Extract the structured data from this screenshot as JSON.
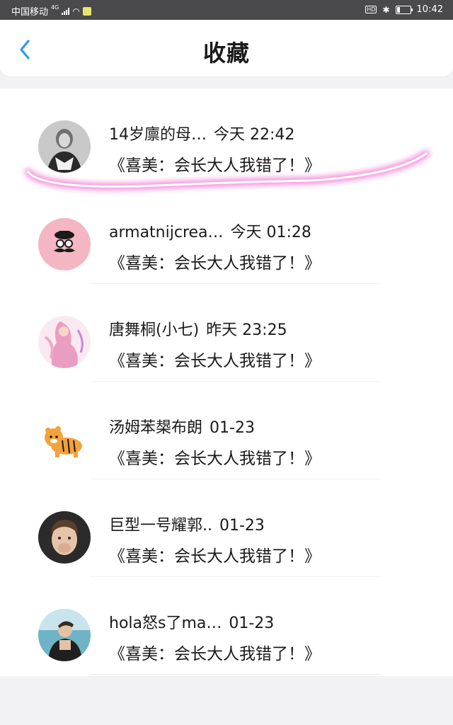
{
  "status_bar": {
    "carrier": "中国移动",
    "network": "4G",
    "time": "10:42",
    "hd": "HD"
  },
  "header": {
    "title": "收藏",
    "back_icon": "chevron-left-icon"
  },
  "colors": {
    "accent": "#2f9be8",
    "status_bar": "#4a4a4c",
    "highlight": "#f06fd0"
  },
  "favorites": [
    {
      "name": "14岁廪的母…",
      "time": "今天 22:42",
      "message": "《喜美：会长大人我错了！》",
      "avatar": "woman-portrait-avatar"
    },
    {
      "name": "armatnijcrea…",
      "time": "今天 01:28",
      "message": "《喜美：会长大人我错了！》",
      "avatar": "mustache-hat-avatar"
    },
    {
      "name": "唐舞桐(小七)",
      "time": "昨天 23:25",
      "message": "《喜美：会长大人我错了！》",
      "avatar": "anime-girl-avatar"
    },
    {
      "name": "汤姆苯槼布朗",
      "time": "01-23",
      "message": "《喜美：会长大人我错了！》",
      "avatar": "tiger-avatar"
    },
    {
      "name": "巨型一号耀郭..",
      "time": "01-23",
      "message": "《喜美：会长大人我错了！》",
      "avatar": "child-avatar"
    },
    {
      "name": "hola怒s了ma…",
      "time": "01-23",
      "message": "《喜美：会长大人我错了！》",
      "avatar": "man-avatar"
    }
  ]
}
